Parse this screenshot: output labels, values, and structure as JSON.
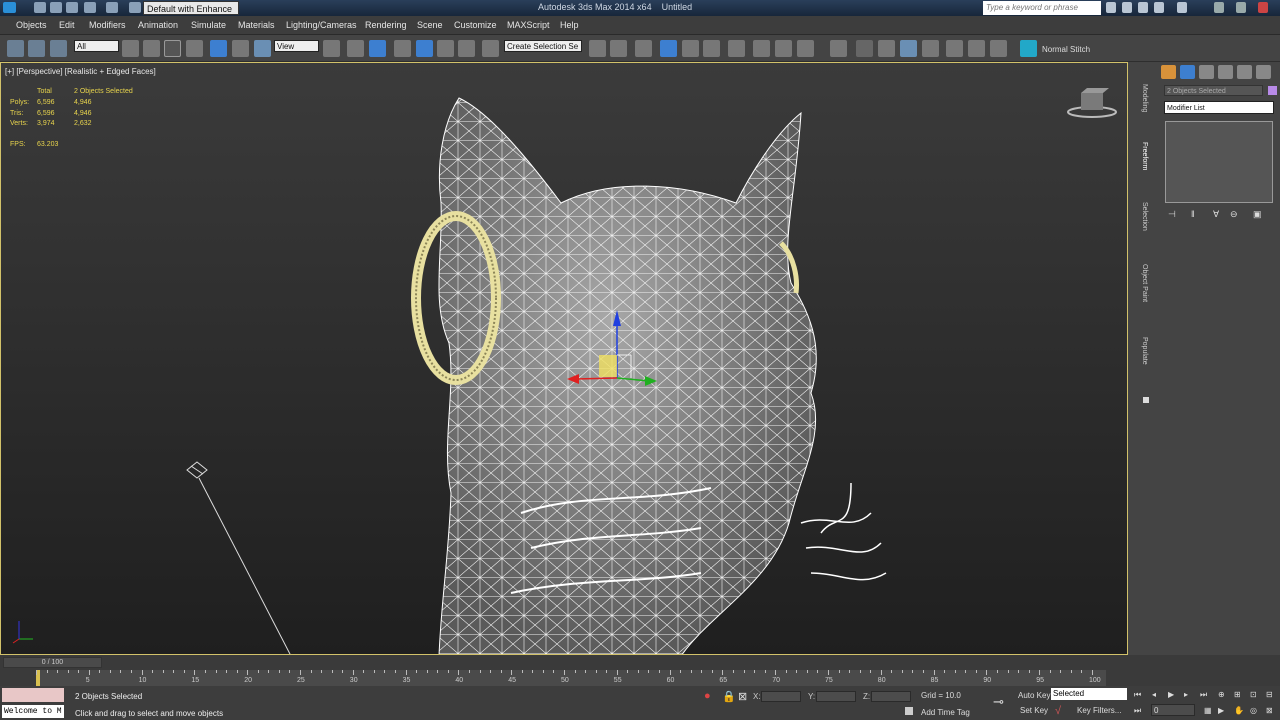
{
  "titlebar": {
    "workspace": "Default with Enhance",
    "app_title": "Autodesk 3ds Max 2014 x64",
    "file_title": "Untitled",
    "search_placeholder": "Type a keyword or phrase"
  },
  "menu": [
    "Objects",
    "Edit",
    "Modifiers",
    "Animation",
    "Simulate",
    "Materials",
    "Lighting/Cameras",
    "Rendering",
    "Scene",
    "Customize",
    "MAXScript",
    "Help"
  ],
  "toolbar": {
    "selection_filter": "All",
    "ref_coord": "View",
    "named_selection": "Create Selection Se",
    "normal_stitch": "Normal Stitch"
  },
  "viewport": {
    "label": "[+] [Perspective] [Realistic + Edged Faces]",
    "stats": {
      "header_total": "Total",
      "header_selected": "2 Objects Selected",
      "rows": [
        {
          "label": "Polys:",
          "total": "6,596",
          "sel": "4,946"
        },
        {
          "label": "Tris:",
          "total": "6,596",
          "sel": "4,946"
        },
        {
          "label": "Verts:",
          "total": "3,974",
          "sel": "2,632"
        }
      ],
      "fps_label": "FPS:",
      "fps_value": "63.203"
    }
  },
  "command_panel": {
    "object_name": "2 Objects Selected",
    "modifier_list": "Modifier List",
    "ribbon_tabs": [
      "Modeling",
      "Freeform",
      "Selection",
      "Object Paint",
      "Populate"
    ],
    "selection_color": "#b88ae8"
  },
  "timeline": {
    "slider": "0 / 100",
    "ticks": [
      "5",
      "10",
      "15",
      "20",
      "25",
      "30",
      "35",
      "40",
      "45",
      "50",
      "55",
      "60",
      "65",
      "70",
      "75",
      "80",
      "85",
      "90",
      "95",
      "100"
    ]
  },
  "statusbar": {
    "welcome": "Welcome to M",
    "objects_selected": "2 Objects Selected",
    "prompt": "Click and drag to select and move objects",
    "x_label": "X:",
    "y_label": "Y:",
    "z_label": "Z:",
    "grid": "Grid = 10.0",
    "add_time_tag": "Add Time Tag",
    "auto_key": "Auto Key",
    "set_key": "Set Key",
    "key_mode": "Selected",
    "key_filters": "Key Filters...",
    "frame": "0"
  }
}
